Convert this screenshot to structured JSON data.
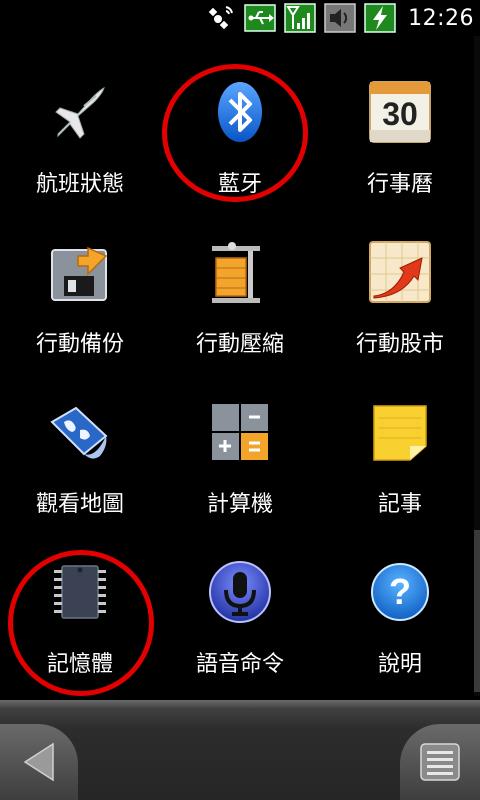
{
  "status_bar": {
    "time": "12:26",
    "icons": [
      "gps-icon",
      "usb-icon",
      "signal-icon",
      "speaker-icon",
      "battery-charging-icon"
    ]
  },
  "apps": [
    {
      "label": "航班狀態",
      "icon": "airplane-icon"
    },
    {
      "label": "藍牙",
      "icon": "bluetooth-icon"
    },
    {
      "label": "行事曆",
      "icon": "calendar-icon",
      "icon_text": "30"
    },
    {
      "label": "行動備份",
      "icon": "backup-icon"
    },
    {
      "label": "行動壓縮",
      "icon": "compress-icon"
    },
    {
      "label": "行動股市",
      "icon": "stock-chart-icon"
    },
    {
      "label": "觀看地圖",
      "icon": "map-icon"
    },
    {
      "label": "計算機",
      "icon": "calculator-icon"
    },
    {
      "label": "記事",
      "icon": "notes-icon"
    },
    {
      "label": "記憶體",
      "icon": "memory-chip-icon"
    },
    {
      "label": "語音命令",
      "icon": "microphone-icon"
    },
    {
      "label": "說明",
      "icon": "help-icon",
      "icon_text": "?"
    }
  ],
  "highlighted_apps": [
    "藍牙",
    "記憶體"
  ],
  "colors": {
    "highlight": "#e30000",
    "status_green": "#1e8a1e"
  },
  "bottom_bar": {
    "back_icon": "back-arrow-icon",
    "menu_icon": "menu-icon"
  }
}
